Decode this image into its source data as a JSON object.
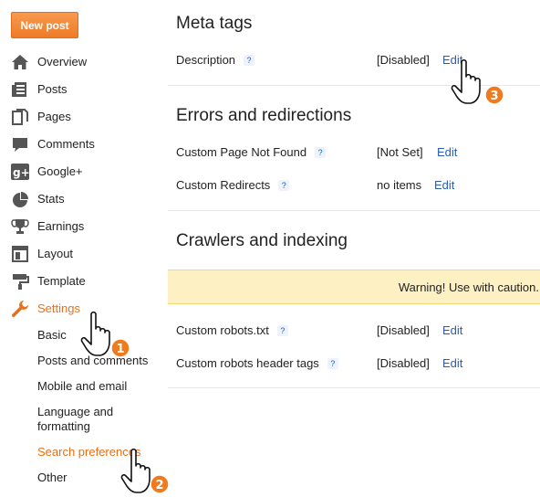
{
  "sidebar": {
    "new_post_label": "New post",
    "items": [
      {
        "label": "Overview",
        "icon": "home-icon"
      },
      {
        "label": "Posts",
        "icon": "posts-icon"
      },
      {
        "label": "Pages",
        "icon": "pages-icon"
      },
      {
        "label": "Comments",
        "icon": "comments-icon"
      },
      {
        "label": "Google+",
        "icon": "google-plus-icon"
      },
      {
        "label": "Stats",
        "icon": "stats-icon"
      },
      {
        "label": "Earnings",
        "icon": "earnings-icon"
      },
      {
        "label": "Layout",
        "icon": "layout-icon"
      },
      {
        "label": "Template",
        "icon": "template-icon"
      },
      {
        "label": "Settings",
        "icon": "wrench-icon",
        "active": true
      }
    ],
    "settings_sub": [
      "Basic",
      "Posts and comments",
      "Mobile and email",
      "Language and formatting",
      "Search preferences",
      "Other"
    ]
  },
  "main": {
    "meta_tags": {
      "title": "Meta tags",
      "description_label": "Description",
      "description_value": "[Disabled]",
      "edit": "Edit"
    },
    "errors": {
      "title": "Errors and redirections",
      "not_found_label": "Custom Page Not Found",
      "not_found_value": "[Not Set]",
      "redirects_label": "Custom Redirects",
      "redirects_value": "no items",
      "edit": "Edit"
    },
    "crawlers": {
      "title": "Crawlers and indexing",
      "warning": "Warning! Use with caution.",
      "robots_label": "Custom robots.txt",
      "robots_value": "[Disabled]",
      "header_tags_label": "Custom robots header tags",
      "header_tags_value": "[Disabled]",
      "edit": "Edit"
    },
    "help_glyph": "?"
  },
  "annotations": [
    "1",
    "2",
    "3"
  ],
  "colors": {
    "accent": "#e8701a",
    "link": "#2a5db0",
    "warning_bg": "#fdf1c3",
    "badge": "#f07a1e"
  }
}
